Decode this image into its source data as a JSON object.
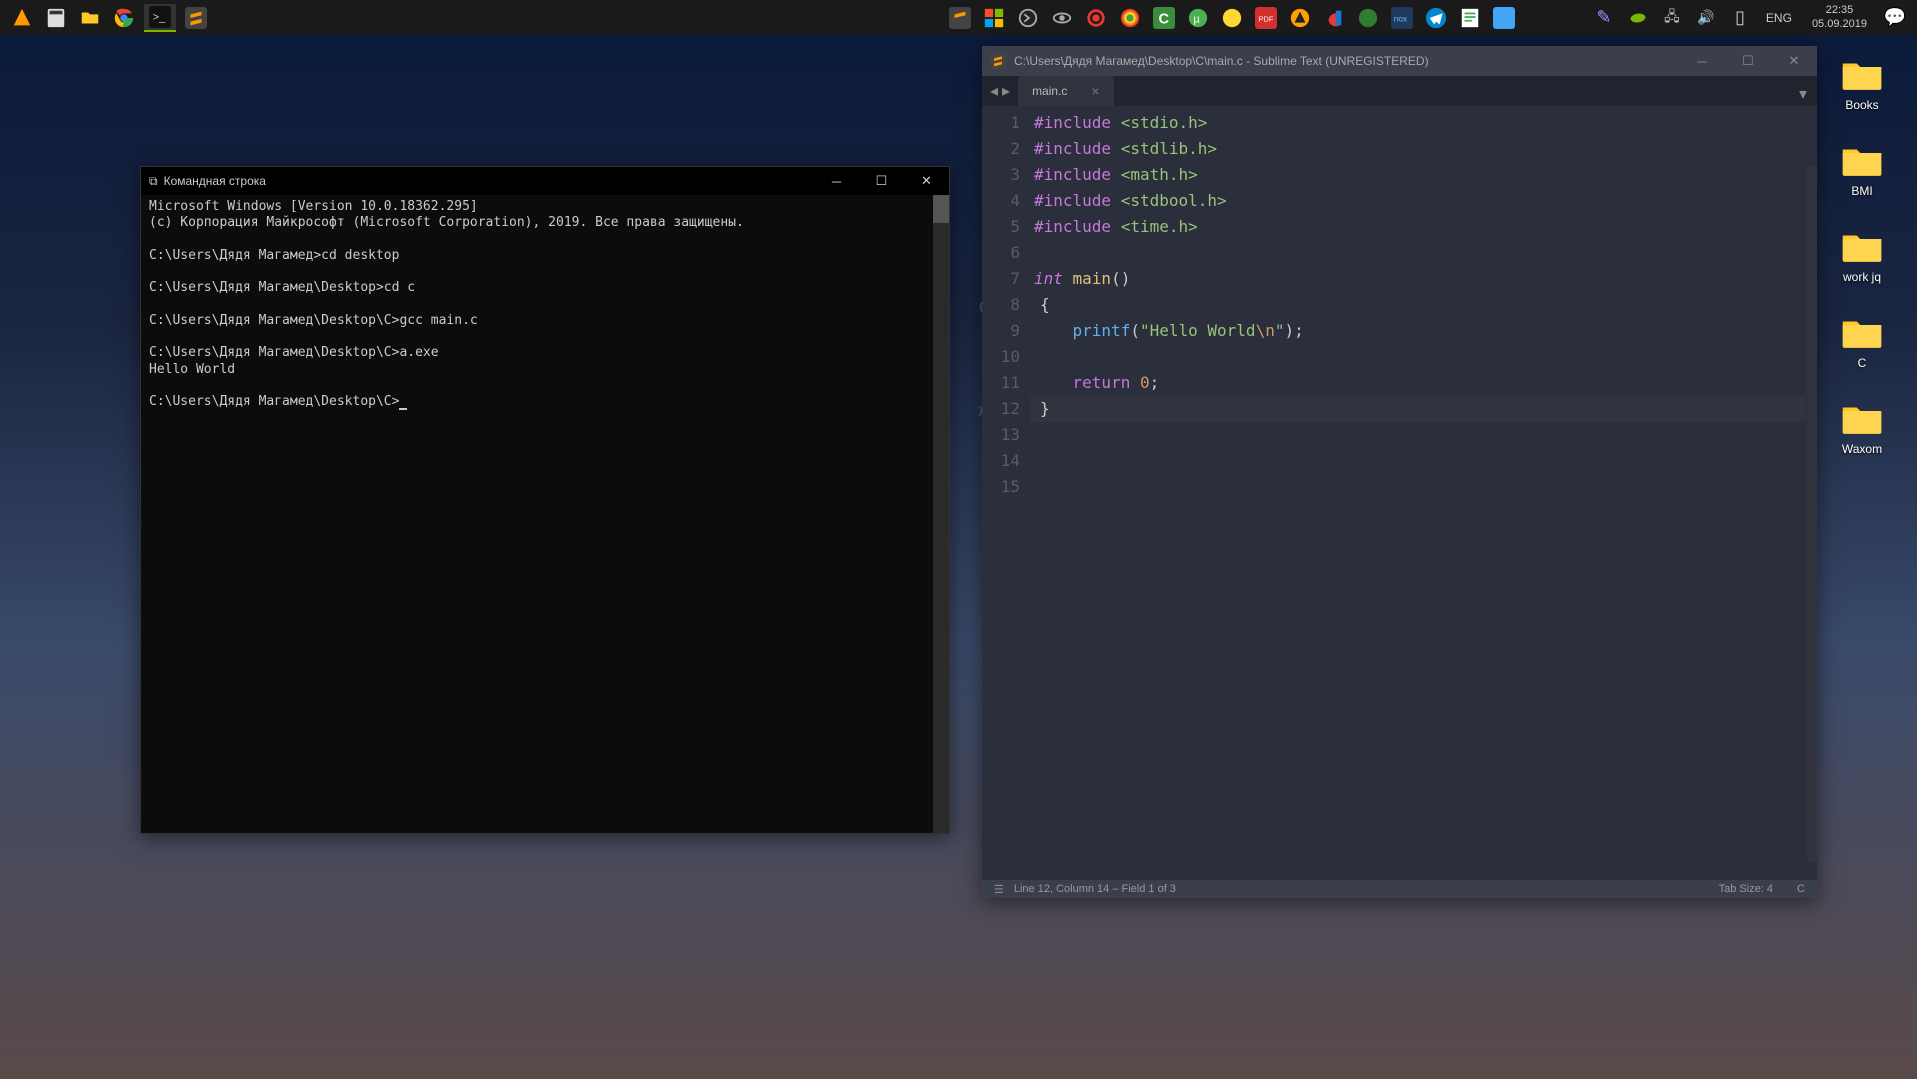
{
  "taskbar": {
    "time": "22:35",
    "date": "05.09.2019",
    "lang": "ENG"
  },
  "desktop": {
    "icons": [
      {
        "label": "Books"
      },
      {
        "label": "BMI"
      },
      {
        "label": "work jq"
      },
      {
        "label": "C"
      },
      {
        "label": "Waxom"
      }
    ]
  },
  "cmd": {
    "title": "Командная строка",
    "lines": [
      "Microsoft Windows [Version 10.0.18362.295]",
      "(c) Корпорация Майкрософт (Microsoft Corporation), 2019. Все права защищены.",
      "",
      "C:\\Users\\Дядя Магамед>cd desktop",
      "",
      "C:\\Users\\Дядя Магамед\\Desktop>cd c",
      "",
      "C:\\Users\\Дядя Магамед\\Desktop\\C>gcc main.c",
      "",
      "C:\\Users\\Дядя Магамед\\Desktop\\C>a.exe",
      "Hello World",
      "",
      "C:\\Users\\Дядя Магамед\\Desktop\\C>"
    ]
  },
  "sublime": {
    "title": "C:\\Users\\Дядя Магамед\\Desktop\\C\\main.c - Sublime Text (UNREGISTERED)",
    "tab": "main.c",
    "status_left": "Line 12, Column 14 – Field 1 of 3",
    "status_tabsize": "Tab Size: 4",
    "status_syntax": "C",
    "code": {
      "l1": {
        "a": "#include ",
        "b": "<stdio.h>"
      },
      "l2": {
        "a": "#include ",
        "b": "<stdlib.h>"
      },
      "l3": {
        "a": "#include ",
        "b": "<math.h>"
      },
      "l4": {
        "a": "#include ",
        "b": "<stdbool.h>"
      },
      "l5": {
        "a": "#include ",
        "b": "<time.h>"
      },
      "l7": {
        "a": "int ",
        "b": "main",
        "c": "()"
      },
      "l8": "{",
      "l10": {
        "a": "    ",
        "b": "printf",
        "c": "(",
        "d": "\"Hello World",
        "e": "\\n",
        "f": "\"",
        "g": ");"
      },
      "l12": {
        "a": "    ",
        "b": "return ",
        "c": "0",
        "d": ";"
      },
      "l13": "}"
    },
    "line_numbers": [
      "1",
      "2",
      "3",
      "4",
      "5",
      "6",
      "7",
      "8",
      "9",
      "10",
      "11",
      "12",
      "13",
      "14",
      "15"
    ]
  }
}
